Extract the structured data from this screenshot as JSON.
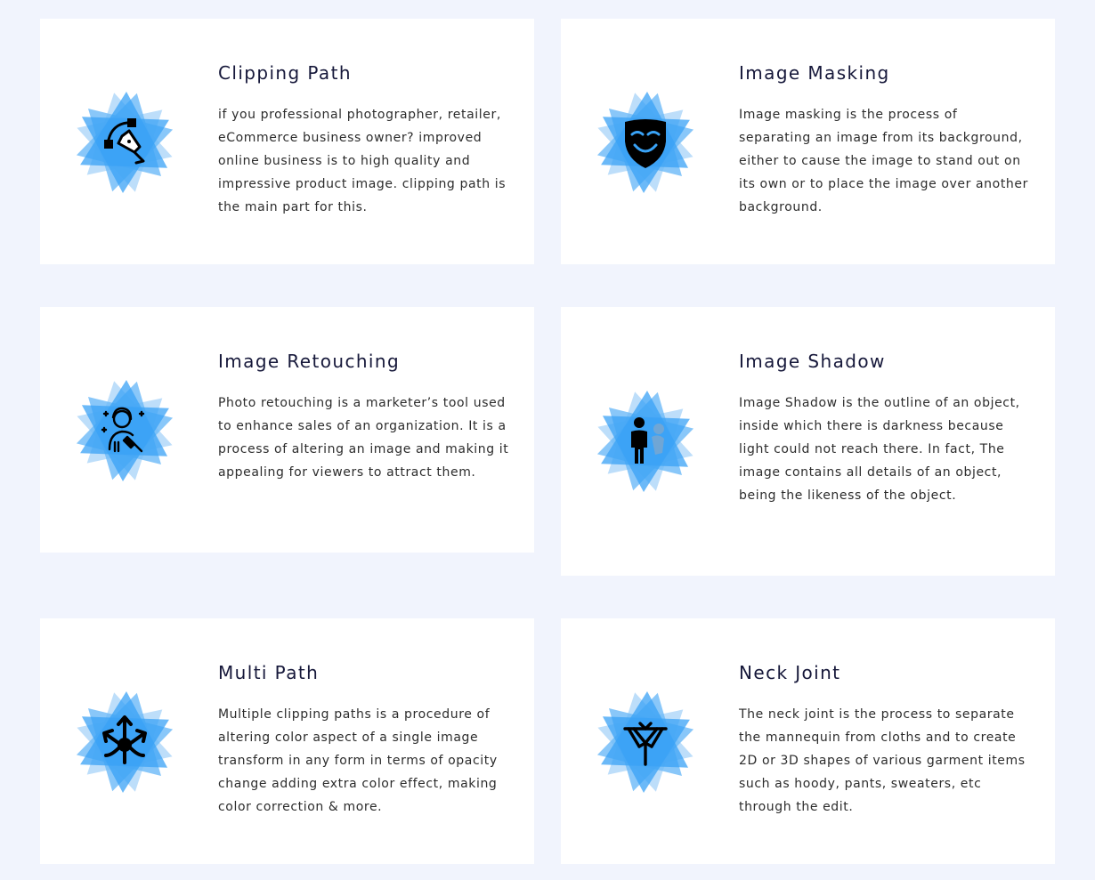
{
  "colors": {
    "page_background": "#f1f4fd",
    "card_background": "#ffffff",
    "badge_light": "#b9dcfa",
    "badge_mid": "#6cb9f7",
    "badge_dark": "#39a2f5",
    "title_text": "#16183a",
    "body_text": "#2c2c2c"
  },
  "services": [
    {
      "title": "Clipping Path",
      "icon": "pen-tool-bezier-icon",
      "description": "if you professional photographer, retailer, eCommerce business owner? improved online business is to high quality and impressive product image. clipping path is the main part for this."
    },
    {
      "title": "Image Masking",
      "icon": "smiling-mask-icon",
      "description": "Image masking is the process of separating an image from its background, either to cause the image to stand out on its own or to place the image over another background."
    },
    {
      "title": "Image Retouching",
      "icon": "woman-retouch-brush-icon",
      "description": "Photo retouching is a marketer’s tool used to enhance sales of an organization. It is a process of altering an image and making it appealing for viewers to attract them."
    },
    {
      "title": "Image Shadow",
      "icon": "person-shadow-icon",
      "description": "Image Shadow is the outline of an object, inside which there is darkness because light could not reach there. In fact, The image contains all details of an object, being the likeness of the object."
    },
    {
      "title": "Multi Path",
      "icon": "multi-arrows-icon",
      "description": "Multiple clipping paths is a procedure of altering color aspect of a single image transform in any form in terms of opacity change adding extra color effect, making color correction & more."
    },
    {
      "title": "Neck Joint",
      "icon": "shirt-hanger-icon",
      "description": "The neck joint is the process to separate the mannequin from cloths and to create 2D or 3D shapes of various garment items such as hoody, pants, sweaters, etc through the edit."
    }
  ]
}
